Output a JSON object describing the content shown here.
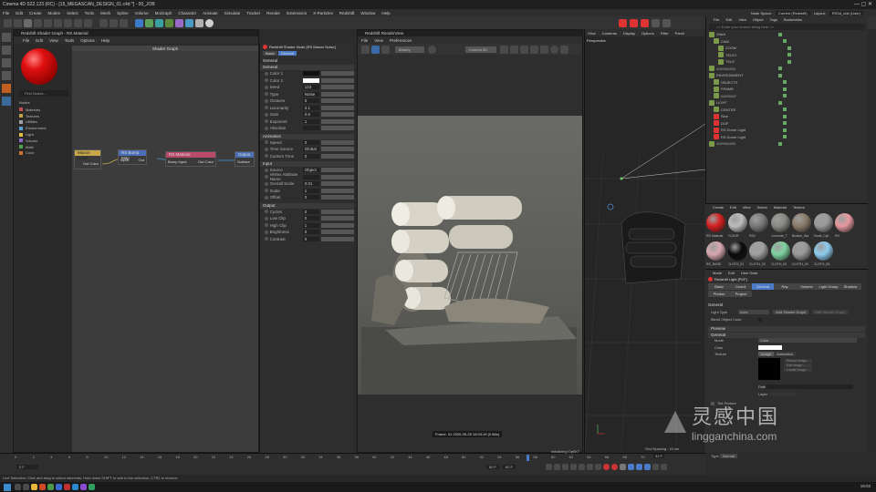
{
  "title_bar": {
    "title": "Cinema 4D S22.123 (RC) - [15_MEGASCAN_DESIGN_01.c4d *] - 00_JOB"
  },
  "main_menu": [
    "File",
    "Edit",
    "Create",
    "Modes",
    "Select",
    "Tools",
    "Mesh",
    "Spline",
    "Volume",
    "MoGraph",
    "Character",
    "Animate",
    "Simulate",
    "Tracker",
    "Render",
    "Extensions",
    "X-Particles",
    "Redshift",
    "Window",
    "Help"
  ],
  "node_space": {
    "label": "Node Space:",
    "value": "Current (Redshift)",
    "layout_label": "Layout:",
    "layout_value": "RS3d_ubb (User)"
  },
  "shader_graph": {
    "window_title": "Redshift Shader Graph - RS Material",
    "menu": [
      "File",
      "Edit",
      "View",
      "Tools",
      "Options",
      "Help"
    ],
    "panel_title": "Shader Graph",
    "search_placeholder": "Find Nodes...",
    "nodes_header": "Nodes",
    "categories": [
      "Materials",
      "Textures",
      "Utilities",
      "Environment",
      "Light",
      "Volume",
      "Math",
      "Color"
    ],
    "nodes": {
      "maxon_noise": {
        "title": "Maxon Noise",
        "port": "Out Color"
      },
      "bump_map": {
        "title": "RS Bump Map",
        "in": "Input",
        "out": "Out"
      },
      "rs_material": {
        "title": "RS Material",
        "in": "Bump Input",
        "out": "Out Color"
      },
      "output": {
        "title": "Output",
        "in": "Surface"
      }
    }
  },
  "attributes": {
    "title": "Redshift Shader Node [RS Maxon Noise]",
    "tabs": [
      "Basic",
      "General"
    ],
    "section_general": "General",
    "general_sub": "General",
    "props": [
      {
        "label": "Color 1",
        "value": ""
      },
      {
        "label": "Color 2",
        "value": ""
      },
      {
        "label": "Seed",
        "value": "123"
      },
      {
        "label": "Type",
        "value": "Noise"
      },
      {
        "label": "Octaves",
        "value": "5"
      },
      {
        "label": "Lacunarity",
        "value": "2.1"
      },
      {
        "label": "Gain",
        "value": "0.5"
      },
      {
        "label": "Exponent",
        "value": "1"
      },
      {
        "label": "Absolute",
        "value": ""
      }
    ],
    "animation_label": "Animation",
    "anim_props": [
      {
        "label": "Speed",
        "value": "0"
      },
      {
        "label": "Time Source",
        "value": "Global"
      },
      {
        "label": "Custom Time",
        "value": "0"
      }
    ],
    "input_label": "Input",
    "input_props": [
      {
        "label": "Source",
        "value": "Object"
      },
      {
        "label": "Vertex Attribute Name",
        "value": ""
      },
      {
        "label": "Overall Scale",
        "value": "0.01"
      },
      {
        "label": "Scale",
        "value": "1"
      },
      {
        "label": "Offset",
        "value": "0"
      }
    ],
    "output_label": "Output",
    "output_props": [
      {
        "label": "Cycles",
        "value": "0"
      },
      {
        "label": "Low Clip",
        "value": "0"
      },
      {
        "label": "High Clip",
        "value": "1"
      },
      {
        "label": "Brightness",
        "value": "0"
      },
      {
        "label": "Contrast",
        "value": "0"
      }
    ]
  },
  "renderview": {
    "title": "Redshift RenderView",
    "menu": [
      "File",
      "View",
      "Preferences"
    ],
    "aov": "Beauty",
    "camera": "Cinema 4D",
    "status": "Frame: 31  2020-09-25 19:03:19  (0.86s)"
  },
  "viewport": {
    "menu": [
      "View",
      "Cameras",
      "Display",
      "Options",
      "Filter",
      "Panel"
    ],
    "label": "Perspective",
    "grid_spacing": "Grid Spacing : 10 cm"
  },
  "object_manager": {
    "menu": [
      "File",
      "Edit",
      "View",
      "Object",
      "Tags",
      "Bookmarks"
    ],
    "search_placeholder": "<< Enter your search string here >>",
    "objects": [
      "Stitch",
      "CAM",
      "ZOOM",
      "TELE1",
      "TELE",
      "///////////////////",
      "ENVIRONMENT",
      "OBJECTS",
      "FRAME",
      "///////////////",
      "LIGHT",
      "CENTER",
      "Sine",
      "DOF",
      "RS Dome Light",
      "RS Dome Light",
      "///////////////////"
    ]
  },
  "material_manager": {
    "menu": [
      "Create",
      "Edit",
      "View",
      "Select",
      "Material",
      "Texture"
    ],
    "materials": [
      {
        "name": "RS Material",
        "color": "#d62020"
      },
      {
        "name": "FLOOR",
        "color": "#bdbdbd"
      },
      {
        "name": "RS2",
        "color": "#7a7a7a"
      },
      {
        "name": "Concrete_T",
        "color": "#8a8a85"
      },
      {
        "name": "Broken_Wa",
        "color": "#8b7c6a"
      },
      {
        "name": "Small_Cyli",
        "color": "#9a9a9a"
      },
      {
        "name": "RS",
        "color": "#e89aa0"
      },
      {
        "name": "RS_BASE",
        "color": "#d8a8b0"
      },
      {
        "name": "CLOTH_01",
        "color": "#0a0a0a"
      },
      {
        "name": "CLOTH_02",
        "color": "#a0a0a0"
      },
      {
        "name": "CLOTH_03",
        "color": "#7fd3a0"
      },
      {
        "name": "CLOTH_04",
        "color": "#9a9a9a"
      },
      {
        "name": "CLOTH_05",
        "color": "#8ecdf0"
      }
    ]
  },
  "attr2": {
    "menu": [
      "Mode",
      "Edit",
      "User Data"
    ],
    "title": "Redshift Light [PDF]",
    "tabs": [
      "Basic",
      "Coord.",
      "General",
      "Ray",
      "Volume",
      "Light Group",
      "Shadow",
      "Photon",
      "Project"
    ],
    "section": "General",
    "light_type_label": "Light Type",
    "light_type": "Area",
    "add_shader_graph": "Add Shader Graph",
    "edit_shader_graph": "Edit Shader Graph",
    "blend_object_color": "Blend Object Color",
    "preview": "Preview",
    "general2": "General",
    "mode_label": "Mode",
    "mode_value": "Color",
    "color_label": "Color",
    "texture_label": "Texture",
    "image_btn": "Image",
    "animation_btn": "Animation",
    "reload": "Reload Image...",
    "edit_image": "Edit Image...",
    "locate": "Locate Image...",
    "path_label": "Path",
    "layer_label": "Layer",
    "tint_label": "Tint Texture",
    "type_label": "Type",
    "type_value": "Normal"
  },
  "timeline": {
    "ticks": [
      "0",
      "2",
      "4",
      "6",
      "8",
      "10",
      "12",
      "14",
      "16",
      "18",
      "20",
      "22",
      "24",
      "26",
      "28",
      "30",
      "32",
      "34",
      "36",
      "38",
      "40",
      "42",
      "44",
      "46",
      "48",
      "50",
      "52",
      "54",
      "56",
      "58",
      "60",
      "62",
      "64",
      "66",
      "68",
      "70"
    ],
    "start": "0 F",
    "current": "31 F",
    "end": "60 F",
    "end2": "60 F",
    "status": "Initializing OptiX7"
  },
  "statusbar": {
    "text": "Live Selection: Click and drag to select elements. Hold down SHIFT to add to the selection, CTRL to remove."
  },
  "taskbar": {
    "time": "19:03"
  },
  "watermark": {
    "cn": "灵感中国",
    "url": "lingganchina.com"
  }
}
